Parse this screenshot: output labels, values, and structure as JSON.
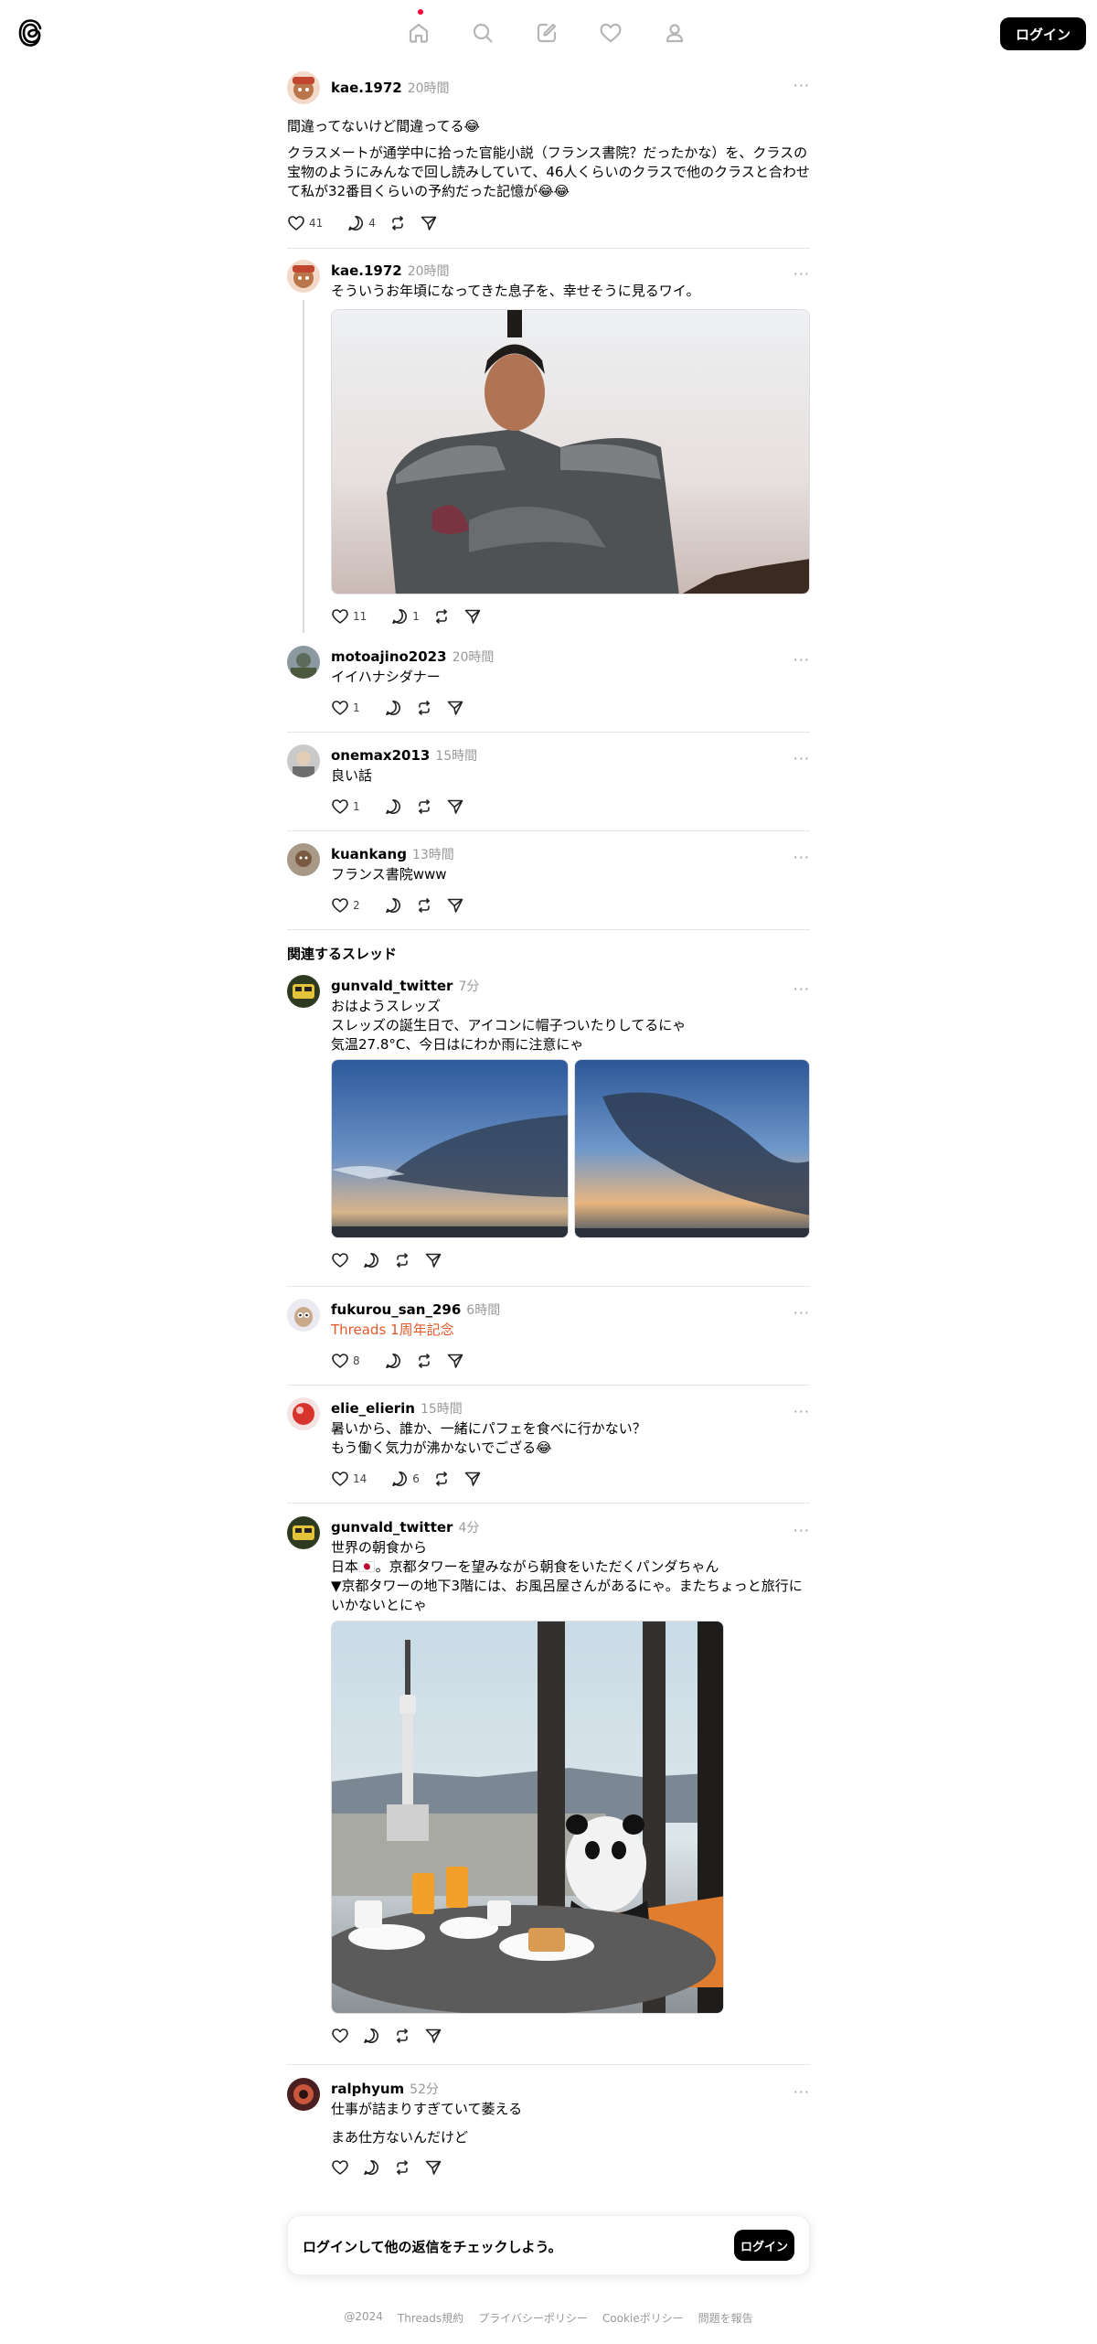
{
  "header": {
    "nav": [
      "home-icon",
      "search-icon",
      "compose-icon",
      "heart-icon",
      "profile-icon"
    ],
    "login_label": "ログイン"
  },
  "posts": [
    {
      "username": "kae.1972",
      "time": "20時間",
      "more": "···",
      "text1": "間違ってないけど間違ってる😂",
      "text2": "クラスメートが通学中に拾った官能小説（フランス書院？だったかな）を、クラスの宝物のようにみんなで回し読みしていて、46人くらいのクラスで他のクラスと合わせて私が32番目くらいの予約だった記憶が😂😂",
      "likes": "41",
      "replies": "4"
    },
    {
      "username": "kae.1972",
      "time": "20時間",
      "more": "···",
      "text": "そういうお年頃になってきた息子を、幸せそうに見るワイ。",
      "likes": "11",
      "replies": "1"
    },
    {
      "username": "motoajino2023",
      "time": "20時間",
      "more": "···",
      "text": "イイハナシダナー",
      "likes": "1"
    },
    {
      "username": "onemax2013",
      "time": "15時間",
      "more": "···",
      "text": "良い話",
      "likes": "1"
    },
    {
      "username": "kuankang",
      "time": "13時間",
      "more": "···",
      "text": "フランス書院www",
      "likes": "2"
    }
  ],
  "related_title": "関連するスレッド",
  "related": [
    {
      "username": "gunvald_twitter",
      "time": "7分",
      "more": "···",
      "text": "おはようスレッズ\nスレッズの誕生日で、アイコンに帽子ついたりしてるにゃ\n気温27.8°C、今日はにわか雨に注意にゃ"
    },
    {
      "username": "fukurou_san_296",
      "time": "6時間",
      "more": "···",
      "text": "Threads 1周年記念",
      "likes": "8"
    },
    {
      "username": "elie_elierin",
      "time": "15時間",
      "more": "···",
      "text": "暑いから、誰か、一緒にパフェを食べに行かない？\nもう働く気力が沸かないでござる😂",
      "likes": "14",
      "replies": "6"
    },
    {
      "username": "gunvald_twitter",
      "time": "4分",
      "more": "···",
      "text": "世界の朝食から\n日本🇯🇵。京都タワーを望みながら朝食をいただくパンダちゃん\n▼京都タワーの地下3階には、お風呂屋さんがあるにゃ。またちょっと旅行にいかないとにゃ"
    },
    {
      "username": "ralphyum",
      "time": "52分",
      "more": "···",
      "text1": "仕事が詰まりすぎていて萎える",
      "text2": "まあ仕方ないんだけど"
    }
  ],
  "login_card": {
    "text": "ログインして他の返信をチェックしよう。",
    "button": "ログイン"
  },
  "footer": [
    "@2024",
    "Threads規約",
    "プライバシーポリシー",
    "Cookieポリシー",
    "問題を報告"
  ]
}
